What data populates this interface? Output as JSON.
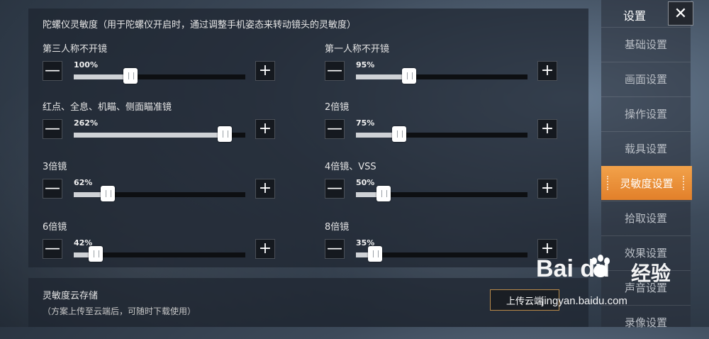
{
  "panel": {
    "title": "陀螺仪灵敏度（用于陀螺仪开启时，通过调整手机姿态来转动镜头的灵敏度）",
    "left_items": [
      {
        "label": "第三人称不开镜",
        "value": "100%",
        "fraction": 0.33
      },
      {
        "label": "红点、全息、机瞄、侧面瞄准镜",
        "value": "262%",
        "fraction": 0.88
      },
      {
        "label": "3倍镜",
        "value": "62%",
        "fraction": 0.2
      },
      {
        "label": "6倍镜",
        "value": "42%",
        "fraction": 0.13
      }
    ],
    "right_items": [
      {
        "label": "第一人称不开镜",
        "value": "95%",
        "fraction": 0.31
      },
      {
        "label": "2倍镜",
        "value": "75%",
        "fraction": 0.25
      },
      {
        "label": "4倍镜、VSS",
        "value": "50%",
        "fraction": 0.16
      },
      {
        "label": "8倍镜",
        "value": "35%",
        "fraction": 0.11
      }
    ],
    "minus_symbol": "—",
    "plus_symbol": "+"
  },
  "cloud": {
    "title": "灵敏度云存储",
    "subtitle": "（方案上传至云端后，可随时下载使用）",
    "upload_label": "上传云端"
  },
  "sidebar": {
    "title": "设置",
    "close_symbol": "✕",
    "items": [
      {
        "label": "基础设置",
        "active": false
      },
      {
        "label": "画面设置",
        "active": false
      },
      {
        "label": "操作设置",
        "active": false
      },
      {
        "label": "载具设置",
        "active": false
      },
      {
        "label": "灵敏度设置",
        "active": true
      },
      {
        "label": "拾取设置",
        "active": false
      },
      {
        "label": "效果设置",
        "active": false
      },
      {
        "label": "声音设置",
        "active": false
      },
      {
        "label": "录像设置",
        "active": false
      }
    ]
  },
  "watermark": {
    "logo": "Bai  du",
    "cn": "经验",
    "url": "jingyan.baidu.com"
  },
  "colors": {
    "accent": "#e8892e",
    "panel_bg": "#1e2530",
    "button_bg": "#15191f"
  }
}
